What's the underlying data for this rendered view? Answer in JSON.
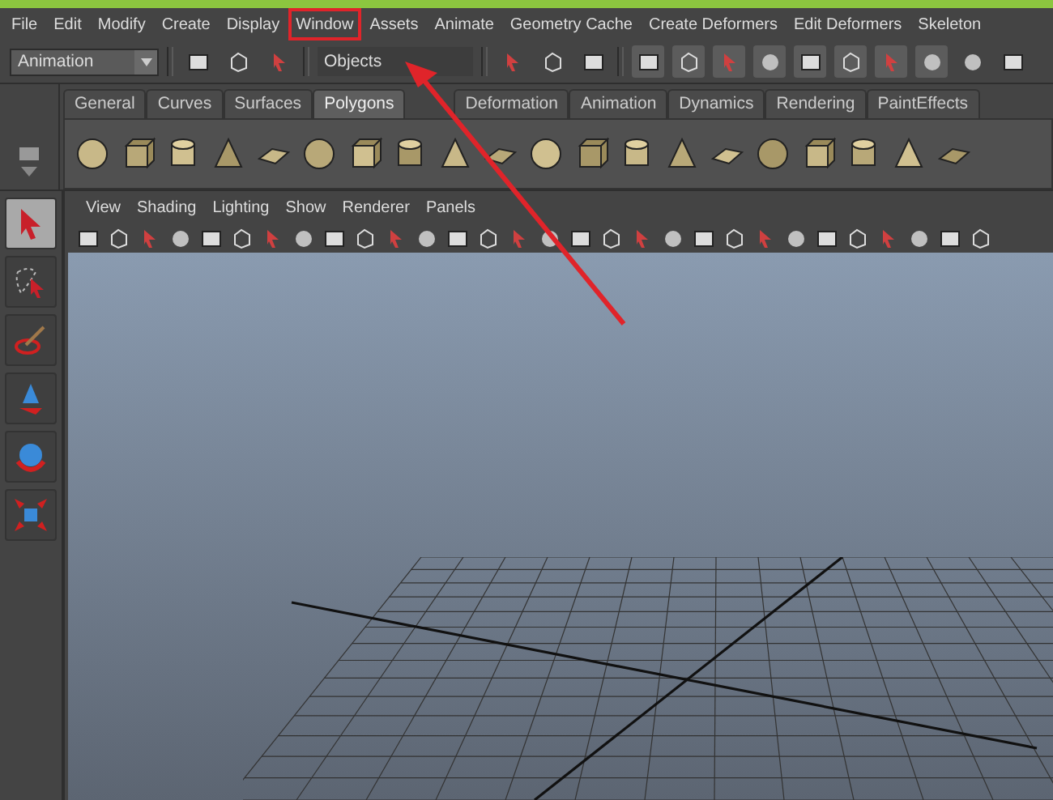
{
  "menu_bar": [
    {
      "label": "File",
      "annotated": false
    },
    {
      "label": "Edit",
      "annotated": false
    },
    {
      "label": "Modify",
      "annotated": false
    },
    {
      "label": "Create",
      "annotated": false
    },
    {
      "label": "Display",
      "annotated": false
    },
    {
      "label": "Window",
      "annotated": true
    },
    {
      "label": "Assets",
      "annotated": false
    },
    {
      "label": "Animate",
      "annotated": false
    },
    {
      "label": "Geometry Cache",
      "annotated": false
    },
    {
      "label": "Create Deformers",
      "annotated": false
    },
    {
      "label": "Edit Deformers",
      "annotated": false
    },
    {
      "label": "Skeleton",
      "annotated": false
    }
  ],
  "status_line": {
    "mode": "Animation",
    "selection_mask": "Objects"
  },
  "shelf_tabs": [
    {
      "label": "General",
      "selected": false
    },
    {
      "label": "Curves",
      "selected": false
    },
    {
      "label": "Surfaces",
      "selected": false
    },
    {
      "label": "Polygons",
      "selected": true
    },
    {
      "label": "Deformation",
      "selected": false
    },
    {
      "label": "Animation",
      "selected": false
    },
    {
      "label": "Dynamics",
      "selected": false
    },
    {
      "label": "Rendering",
      "selected": false
    },
    {
      "label": "PaintEffects",
      "selected": false
    }
  ],
  "toolbox": [
    {
      "selected": true
    },
    {
      "selected": false
    },
    {
      "selected": false
    },
    {
      "selected": false
    },
    {
      "selected": false
    },
    {
      "selected": false
    }
  ],
  "panel_menu": [
    "View",
    "Shading",
    "Lighting",
    "Show",
    "Renderer",
    "Panels"
  ]
}
